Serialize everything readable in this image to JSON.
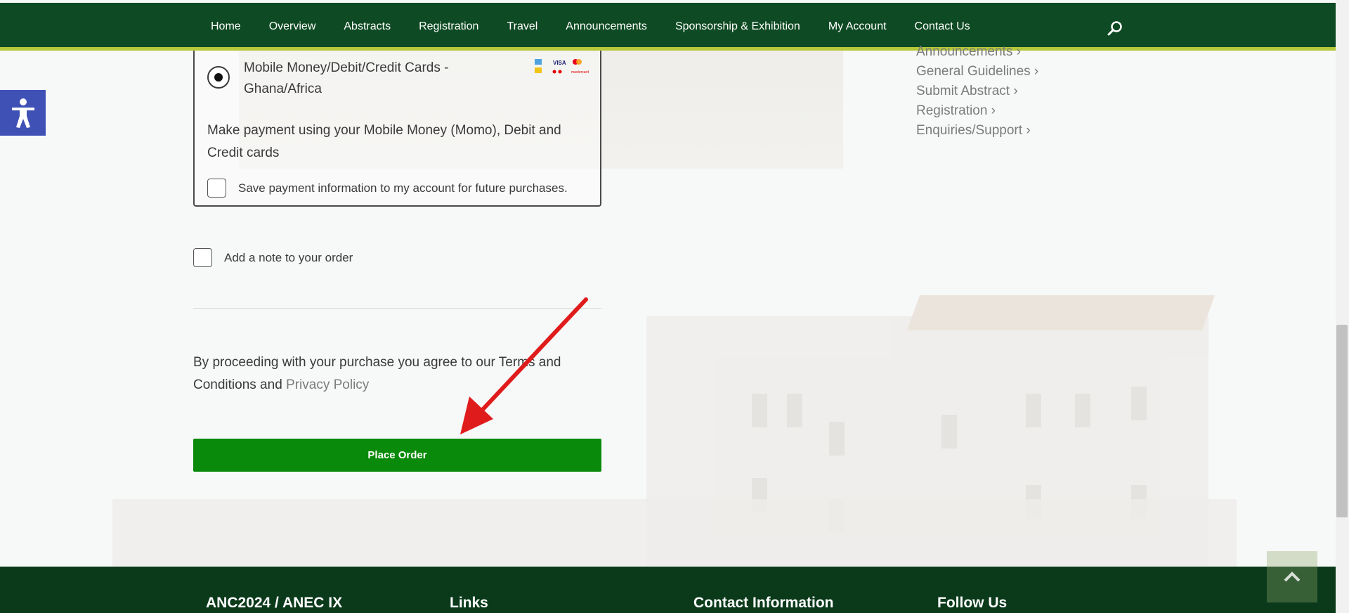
{
  "nav": {
    "items": [
      "Home",
      "Overview",
      "Abstracts",
      "Registration",
      "Travel",
      "Announcements",
      "Sponsorship & Exhibition",
      "My Account",
      "Contact Us"
    ],
    "search_icon": "search-icon"
  },
  "accessibility": {
    "icon": "accessibility-icon"
  },
  "payment": {
    "method_title": "Mobile Money/Debit/Credit Cards - Ghana/Africa",
    "description": "Make payment using your Mobile Money (Momo), Debit and Credit cards",
    "save_label": "Save payment information to my account for future purchases.",
    "logos": [
      "VISA",
      "mastercard"
    ]
  },
  "order": {
    "note_label": "Add a note to your order",
    "terms_text": "By proceeding with your purchase you agree to our Terms and Conditions and ",
    "privacy_link": "Privacy Policy",
    "place_order_label": "Place Order"
  },
  "sidebar": {
    "links": [
      "Announcements ›",
      "General Guidelines ›",
      "Submit Abstract ›",
      "Registration ›",
      "Enquiries/Support ›"
    ]
  },
  "footer": {
    "headings": [
      "ANC2024 / ANEC IX",
      "Links",
      "Contact Information",
      "Follow Us"
    ]
  },
  "colors": {
    "nav_bg": "#0e4a23",
    "nav_accent": "#b6c93a",
    "button_green": "#0a8a0a",
    "footer_bg": "#0b3a1b",
    "annotation_arrow": "#e01b1b",
    "a11y_blue": "#3f51b5"
  }
}
